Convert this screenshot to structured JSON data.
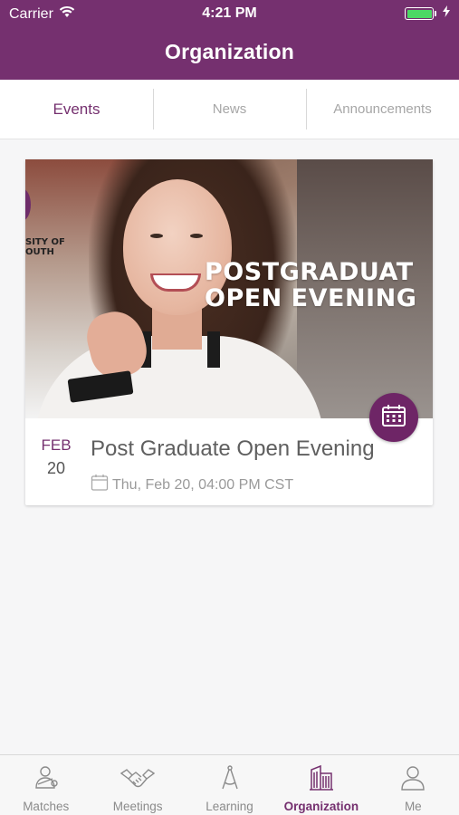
{
  "status_bar": {
    "carrier": "Carrier",
    "time": "4:21 PM",
    "battery_level": 1.0
  },
  "header": {
    "title": "Organization"
  },
  "tabs": [
    {
      "label": "Events",
      "active": true
    },
    {
      "label": "News",
      "active": false
    },
    {
      "label": "Announcements",
      "active": false
    }
  ],
  "event": {
    "image_banner_line1": "POSTGRADUAT",
    "image_banner_line2": "OPEN EVENING",
    "image_logo_line1": "SITY OF",
    "image_logo_line2": "OUTH",
    "month": "FEB",
    "day": "20",
    "title": "Post Graduate Open Evening",
    "datetime": "Thu, Feb 20, 04:00 PM CST",
    "fab_icon": "calendar-icon"
  },
  "bottom_nav": [
    {
      "label": "Matches",
      "icon": "matches-icon",
      "active": false
    },
    {
      "label": "Meetings",
      "icon": "handshake-icon",
      "active": false
    },
    {
      "label": "Learning",
      "icon": "compass-icon",
      "active": false
    },
    {
      "label": "Organization",
      "icon": "building-icon",
      "active": true
    },
    {
      "label": "Me",
      "icon": "person-icon",
      "active": false
    }
  ],
  "colors": {
    "brand": "#75306f",
    "fab": "#6e2566",
    "battery": "#4cd964"
  }
}
